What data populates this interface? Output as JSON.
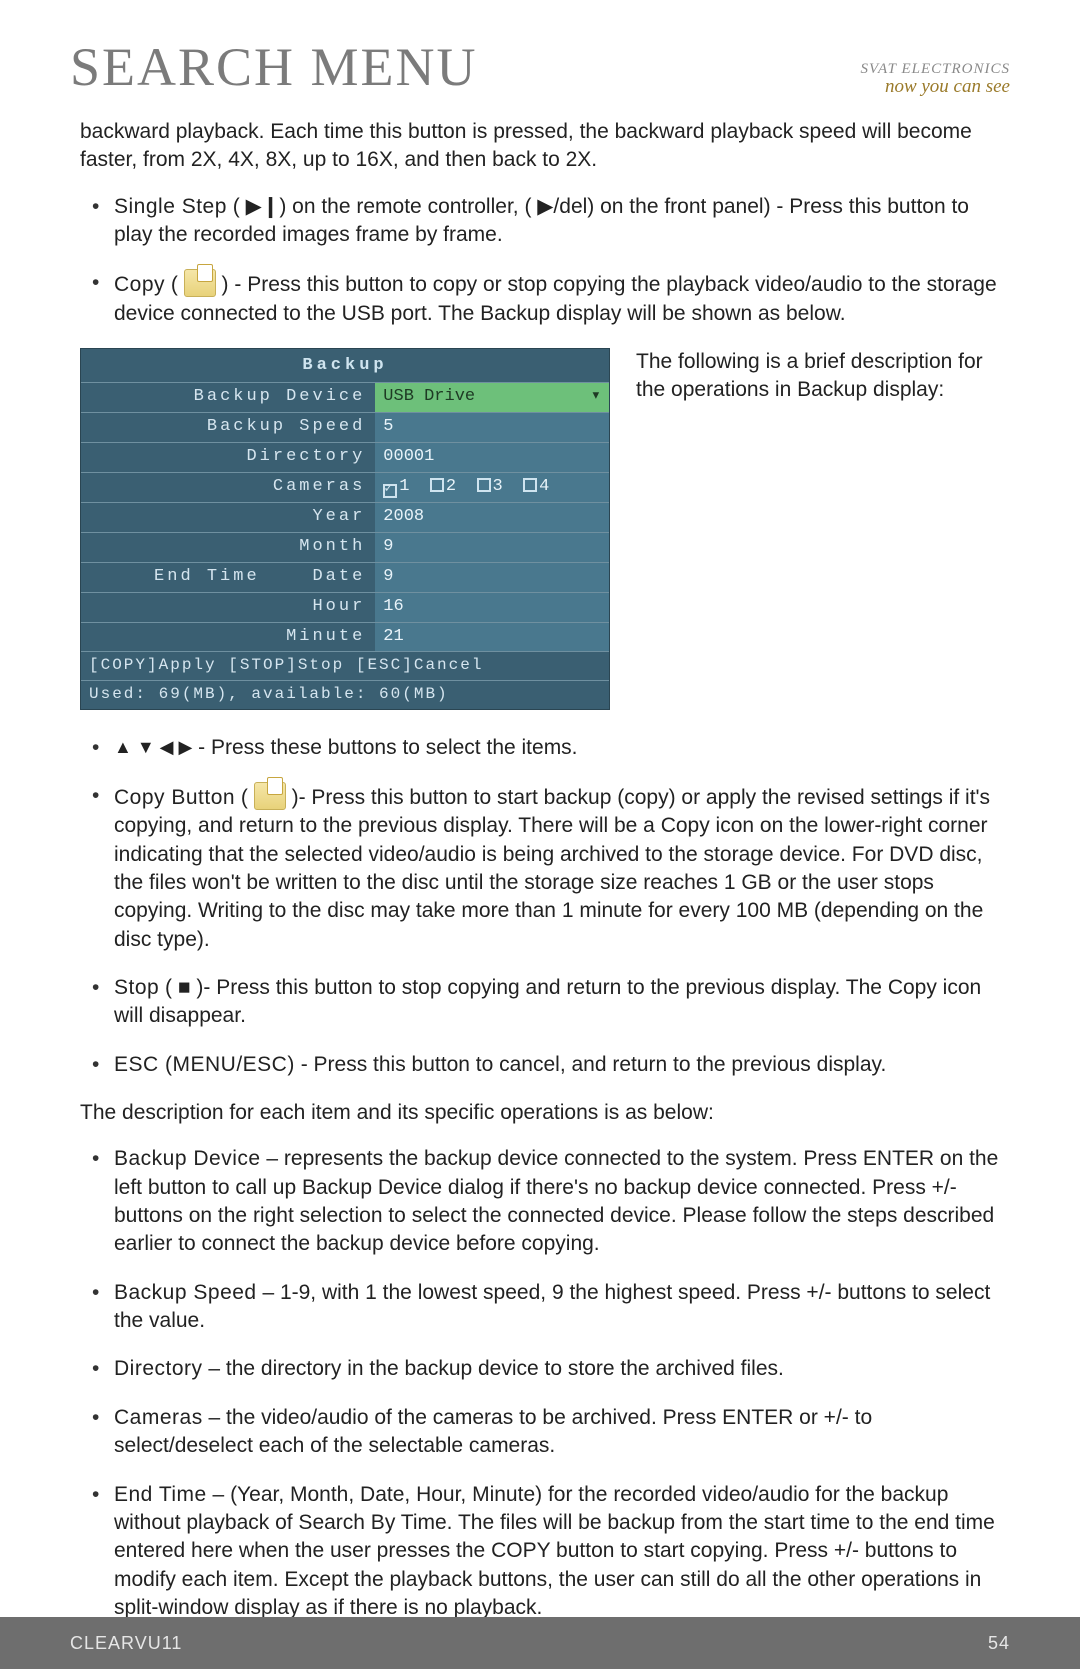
{
  "header": {
    "title": "SEARCH MENU",
    "brand_top": "SVAT ELECTRONICS",
    "brand_tag": "now you can see"
  },
  "intro": "backward playback. Each time this button is pressed, the backward playback speed will become faster, from 2X, 4X, 8X, up to 16X, and then back to 2X.",
  "bullets1": {
    "single_step_label": "Single Step",
    "single_step_text": " ( ▶❙) on the remote controller,  ( ▶/del)  on the front panel)  - Press this button to play the recorded images frame by frame.",
    "copy_label": "Copy",
    "copy_text": " ) - Press this button to copy or stop copying the playback video/audio to the storage device connected to the USB port. The Backup display will be shown as below."
  },
  "side_note": "The following is a brief description for the operations in Backup display:",
  "backup": {
    "title": "Backup",
    "rows": {
      "device_lbl": "Backup Device",
      "device_val": "USB Drive",
      "speed_lbl": "Backup Speed",
      "speed_val": "5",
      "dir_lbl": "Directory",
      "dir_val": "00001",
      "cam_lbl": "Cameras",
      "cam1": "1",
      "cam2": "2",
      "cam3": "3",
      "cam4": "4",
      "endtime_lbl": "End Time",
      "year_lbl": "Year",
      "year_val": "2008",
      "month_lbl": "Month",
      "month_val": "9",
      "date_lbl": "Date",
      "date_val": "9",
      "hour_lbl": "Hour",
      "hour_val": "16",
      "min_lbl": "Minute",
      "min_val": "21"
    },
    "foot1": "[COPY]Apply   [STOP]Stop      [ESC]Cancel",
    "foot2": "Used: 69(MB), available: 60(MB)"
  },
  "bullets2": {
    "arrows_text": "- Press these buttons to select the items.",
    "copybtn_label": "Copy Button",
    "copybtn_text": " )- Press this button to start backup (copy) or apply the revised settings if it's copying, and return to the previous display. There will be a Copy icon on the lower-right corner indicating that the selected video/audio is being archived to the storage device. For DVD disc, the files won't be written to the disc until the storage size reaches 1 GB or the user stops copying. Writing to the disc may take more than 1 minute for every 100 MB (depending on the disc type).",
    "stop_label": "Stop",
    "stop_text": " ( ■ )- Press this button to stop copying and return to the previous display. The Copy icon will disappear.",
    "esc_label": "ESC (MENU/ESC)",
    "esc_text": " - Press this button to cancel, and return to the previous display."
  },
  "desc_heading": "The description for each item and its specific operations is as below:",
  "bullets3": {
    "bd_label": "Backup Device",
    "bd_text": " – represents the backup device connected to the system. Press ENTER on the left button to call up Backup Device dialog if there's no backup device connected. Press +/- buttons on the right selection to select the connected device. Please follow the steps described earlier to connect the backup device before copying.",
    "bs_label": "Backup Speed",
    "bs_text": " – 1-9, with 1 the lowest speed, 9 the highest speed. Press +/- buttons to select the value.",
    "dir_label": "Directory",
    "dir_text": " – the directory in the backup device to store the archived files.",
    "cam_label": "Cameras",
    "cam_text": " – the video/audio of the cameras to be archived. Press ENTER or +/- to select/deselect each of the selectable cameras.",
    "et_label": "End Time",
    "et_text": " – (Year, Month, Date, Hour, Minute) for the recorded video/audio for the backup without playback of Search By Time. The files will be backup from the start time to the end time entered here when the user presses the COPY button to start copying. Press +/- buttons to modify each item. Except the playback buttons, the user can still do all the other operations in split-window display as if there is no playback."
  },
  "footer": {
    "product": "CLEARVU11",
    "page": "54"
  }
}
